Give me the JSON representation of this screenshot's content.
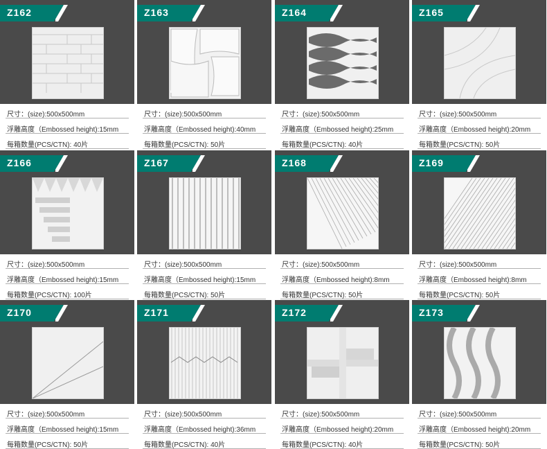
{
  "colors": {
    "card_bg": "#4a4a4a",
    "badge_bg": "#007c70",
    "page_bg": "#ffffff",
    "text": "#333333"
  },
  "products": [
    {
      "code": "Z162",
      "size": "尺寸：(size):500x500mm",
      "height": "浮雕高度（Embossed height):15mm",
      "count": "每箱数量(PCS/CTN): 40片",
      "icon": "stacked-bricks-panel-icon"
    },
    {
      "code": "Z163",
      "size": "尺寸：(size):500x500mm",
      "height": "浮雕高度（Embossed height):40mm",
      "count": "每箱数量(PCS/CTN):  50片",
      "icon": "curved-tiles-panel-icon"
    },
    {
      "code": "Z164",
      "size": "尺寸：(size):500x500mm",
      "height": "浮雕高度（Embossed height):25mm",
      "count": "每箱数量(PCS/CTN): 40片",
      "icon": "wave-ribbons-panel-icon"
    },
    {
      "code": "Z165",
      "size": "尺寸：(size):500x500mm",
      "height": "浮雕高度（Embossed height):20mm",
      "count": "每箱数量(PCS/CTN):  50片",
      "icon": "arc-swirl-panel-icon"
    },
    {
      "code": "Z166",
      "size": "尺寸：(size):500x500mm",
      "height": "浮雕高度（Embossed height):15mm",
      "count": "每箱数量(PCS/CTN):  100片",
      "icon": "triangle-steps-panel-icon"
    },
    {
      "code": "Z167",
      "size": "尺寸：(size):500x500mm",
      "height": "浮雕高度（Embossed height):15mm",
      "count": "每箱数量(PCS/CTN):   50片",
      "icon": "vertical-flutes-panel-icon"
    },
    {
      "code": "Z168",
      "size": "尺寸：(size):500x500mm",
      "height": "浮雕高度（Embossed height):8mm",
      "count": "每箱数量(PCS/CTN):  50片",
      "icon": "diagonal-lines-panel-icon"
    },
    {
      "code": "Z169",
      "size": "尺寸：(size):500x500mm",
      "height": "浮雕高度（Embossed height):8mm",
      "count": "每箱数量(PCS/CTN):  50片",
      "icon": "crossed-diagonals-panel-icon"
    },
    {
      "code": "Z170",
      "size": "尺寸：(size):500x500mm",
      "height": "浮雕高度（Embossed height):15mm",
      "count": "每箱数量(PCS/CTN): 50片",
      "icon": "split-diagonal-panel-icon"
    },
    {
      "code": "Z171",
      "size": "尺寸：(size):500x500mm",
      "height": "浮雕高度（Embossed height):36mm",
      "count": "每箱数量(PCS/CTN):   40片",
      "icon": "ribbed-arches-panel-icon"
    },
    {
      "code": "Z172",
      "size": "尺寸：(size):500x500mm",
      "height": "浮雕高度（Embossed height):20mm",
      "count": "每箱数量(PCS/CTN):  40片",
      "icon": "cross-blocks-panel-icon"
    },
    {
      "code": "Z173",
      "size": "尺寸：(size):500x500mm",
      "height": "浮雕高度（Embossed height):20mm",
      "count": "每箱数量(PCS/CTN):  50片",
      "icon": "double-waves-panel-icon"
    }
  ]
}
